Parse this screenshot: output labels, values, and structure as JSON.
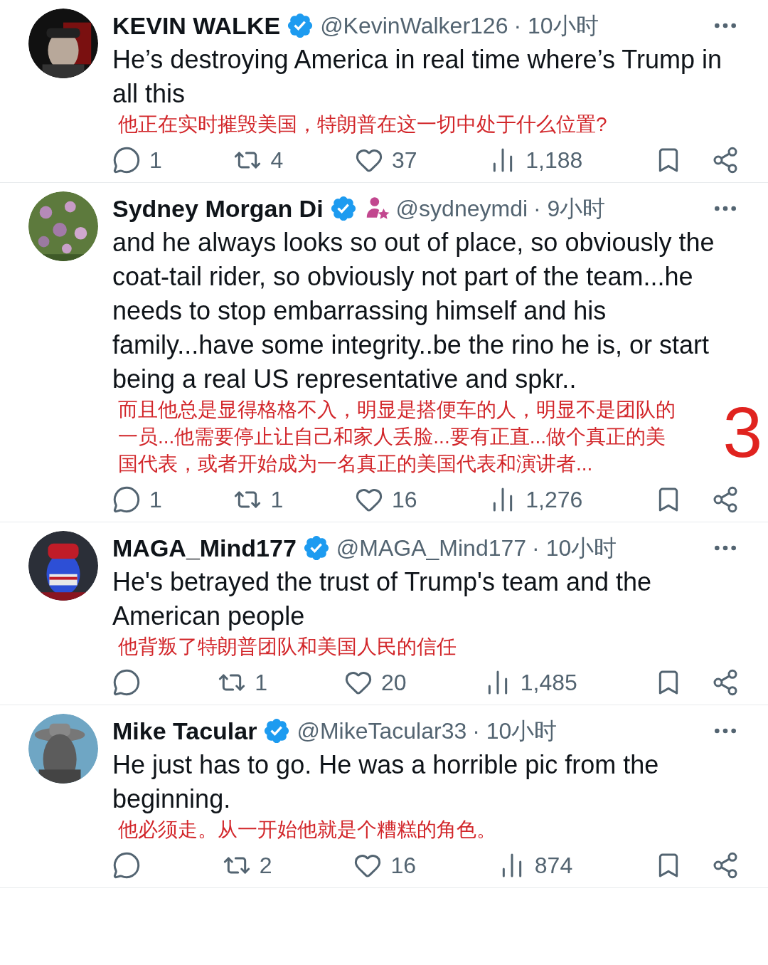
{
  "tweets": [
    {
      "name": "KEVIN WALKE",
      "verified": true,
      "extra_badge": false,
      "handle": "@KevinWalker126",
      "time": "· 10小时",
      "text": "He’s destroying America in real time where’s Trump in all this",
      "translation": "他正在实时摧毁美国，特朗普在这一切中处于什么位置?",
      "replies": "1",
      "reposts": "4",
      "likes": "37",
      "views": "1,188"
    },
    {
      "name": "Sydney Morgan Di",
      "verified": true,
      "extra_badge": true,
      "handle": "@sydneymdi",
      "time": "· 9小时",
      "text": "and he always looks so out of place, so obviously the coat-tail rider, so obviously not part of the team...he needs to stop embarrassing himself and his family...have some integrity..be the rino he is, or start being a real US representative and spkr..",
      "translation": "而且他总是显得格格不入，明显是搭便车的人，明显不是团队的一员...他需要停止让自己和家人丢脸...要有正直...做个真正的美国代表，或者开始成为一名真正的美国代表和演讲者...",
      "replies": "1",
      "reposts": "1",
      "likes": "16",
      "views": "1,276",
      "annotation": "3"
    },
    {
      "name": "MAGA_Mind177",
      "verified": true,
      "extra_badge": false,
      "handle": "@MAGA_Mind177",
      "time": "· 10小时",
      "text": "He's betrayed the trust of Trump's team and the American people",
      "translation": "他背叛了特朗普团队和美国人民的信任",
      "reposts": "1",
      "likes": "20",
      "views": "1,485"
    },
    {
      "name": "Mike Tacular",
      "verified": true,
      "extra_badge": false,
      "handle": "@MikeTacular33",
      "time": "· 10小时",
      "text": "He just has to go. He was a horrible pic from the beginning.",
      "translation": "他必须走。从一开始他就是个糟糕的角色。",
      "reposts": "2",
      "likes": "16",
      "views": "874"
    }
  ]
}
